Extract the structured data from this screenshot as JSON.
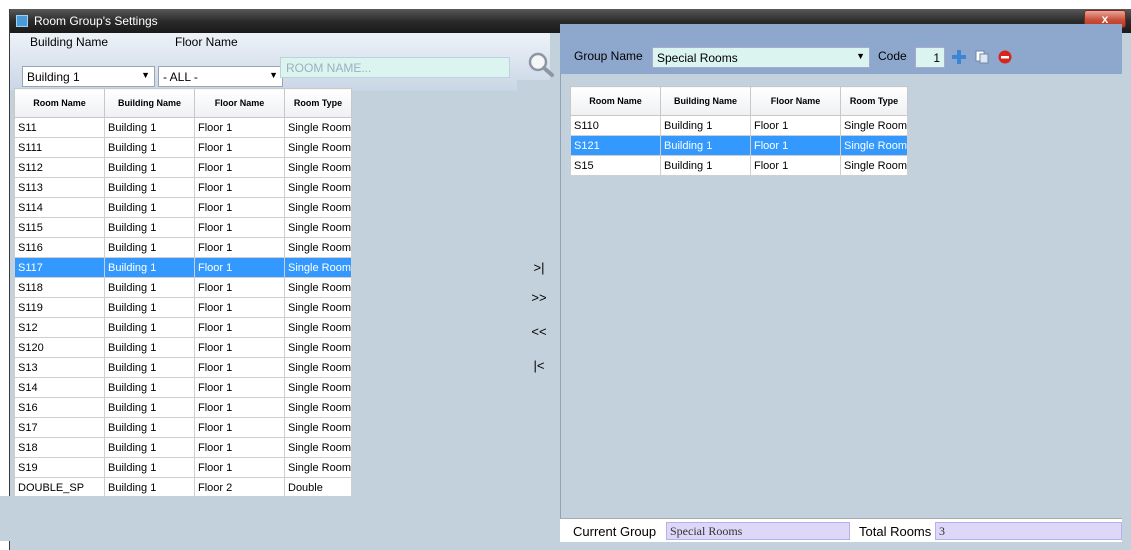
{
  "window": {
    "title": "Room Group's Settings",
    "close": "x"
  },
  "filters": {
    "building_label": "Building Name",
    "building_value": "Building 1",
    "floor_label": "Floor Name",
    "floor_value": "- ALL -",
    "room_placeholder": "ROOM NAME..."
  },
  "columns": [
    "Room Name",
    "Building Name",
    "Floor Name",
    "Room Type"
  ],
  "available_rooms": [
    [
      "S11",
      "Building 1",
      "Floor 1",
      "Single Room"
    ],
    [
      "S111",
      "Building 1",
      "Floor 1",
      "Single Room"
    ],
    [
      "S112",
      "Building 1",
      "Floor 1",
      "Single Room"
    ],
    [
      "S113",
      "Building 1",
      "Floor 1",
      "Single Room"
    ],
    [
      "S114",
      "Building 1",
      "Floor 1",
      "Single Room"
    ],
    [
      "S115",
      "Building 1",
      "Floor 1",
      "Single Room"
    ],
    [
      "S116",
      "Building 1",
      "Floor 1",
      "Single Room"
    ],
    [
      "S117",
      "Building 1",
      "Floor 1",
      "Single Room"
    ],
    [
      "S118",
      "Building 1",
      "Floor 1",
      "Single Room"
    ],
    [
      "S119",
      "Building 1",
      "Floor 1",
      "Single Room"
    ],
    [
      "S12",
      "Building 1",
      "Floor 1",
      "Single Room"
    ],
    [
      "S120",
      "Building 1",
      "Floor 1",
      "Single Room"
    ],
    [
      "S13",
      "Building 1",
      "Floor 1",
      "Single Room"
    ],
    [
      "S14",
      "Building 1",
      "Floor 1",
      "Single Room"
    ],
    [
      "S16",
      "Building 1",
      "Floor 1",
      "Single Room"
    ],
    [
      "S17",
      "Building 1",
      "Floor 1",
      "Single Room"
    ],
    [
      "S18",
      "Building 1",
      "Floor 1",
      "Single Room"
    ],
    [
      "S19",
      "Building 1",
      "Floor 1",
      "Single Room"
    ],
    [
      "DOUBLE_SP",
      "Building 1",
      "Floor 2",
      "Double"
    ]
  ],
  "available_selected_index": 7,
  "move": {
    "move_one": ">|",
    "move_all": ">>",
    "remove_all": "<<",
    "remove_one": "|<"
  },
  "group": {
    "label": "Group Name",
    "value": "Special Rooms",
    "code_label": "Code",
    "code_value": "1",
    "add_icon": "plus-icon",
    "copy_icon": "copy-icon",
    "delete_icon": "delete-icon"
  },
  "group_rooms": [
    [
      "S110",
      "Building 1",
      "Floor 1",
      "Single Room"
    ],
    [
      "S121",
      "Building 1",
      "Floor 1",
      "Single Room"
    ],
    [
      "S15",
      "Building 1",
      "Floor 1",
      "Single Room"
    ]
  ],
  "group_selected_index": 1,
  "footer": {
    "current_group_label": "Current Group",
    "current_group_value": "Special Rooms",
    "total_rooms_label": "Total Rooms",
    "total_rooms_value": "3"
  },
  "colors": {
    "selection": "#3399ff",
    "panel": "#c3d1dc",
    "header": "#8ea8cd"
  }
}
